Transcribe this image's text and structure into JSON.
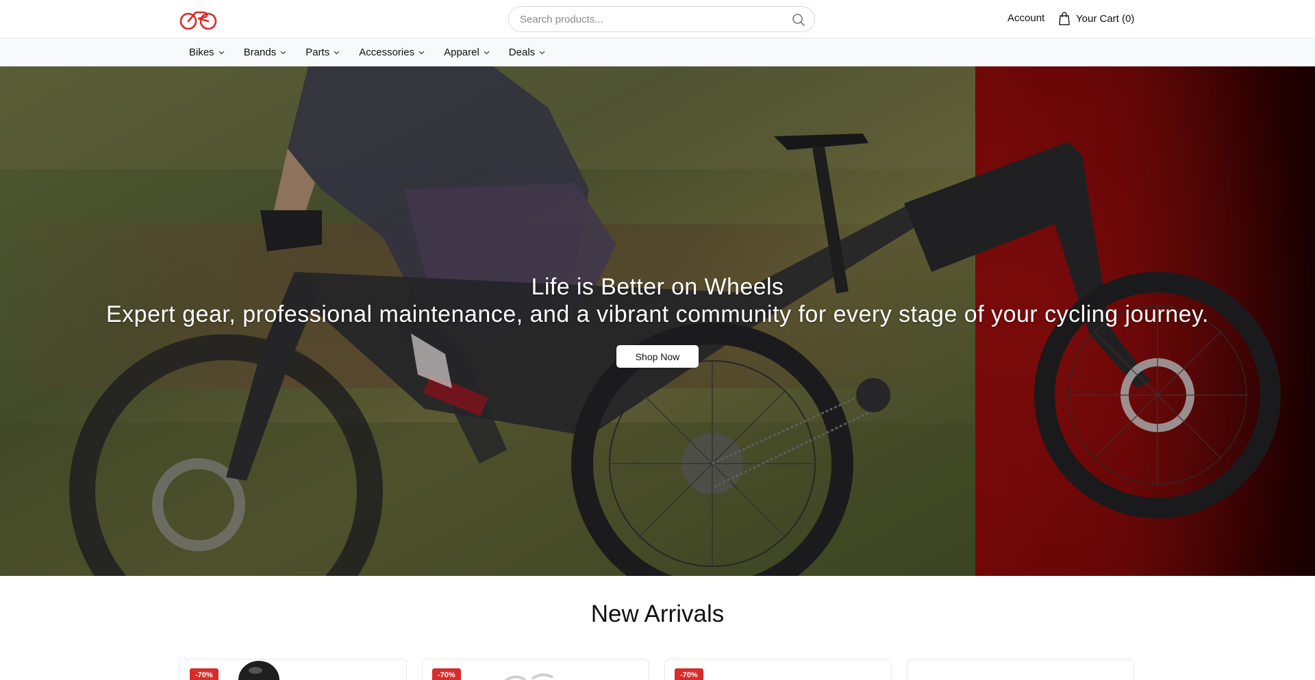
{
  "header": {
    "logo_alt": "Bike shop logo",
    "search_placeholder": "Search products...",
    "account_label": "Account",
    "cart_label": "Your Cart (0)"
  },
  "nav": {
    "items": [
      {
        "label": "Bikes"
      },
      {
        "label": "Brands"
      },
      {
        "label": "Parts"
      },
      {
        "label": "Accessories"
      },
      {
        "label": "Apparel"
      },
      {
        "label": "Deals"
      }
    ]
  },
  "hero": {
    "title": "Life is Better on Wheels",
    "subtitle": "Expert gear, professional maintenance, and a vibrant community for every stage of your cycling journey.",
    "button_label": "Shop Now"
  },
  "new_arrivals": {
    "title": "New Arrivals",
    "products": [
      {
        "badge": "-70%"
      },
      {
        "badge": "-70%"
      },
      {
        "badge": "-70%"
      },
      {
        "badge": ""
      }
    ]
  },
  "colors": {
    "brand_red": "#d62a2a",
    "badge_red": "#d92b2b",
    "hero_red_panel": "#7a0a0a"
  },
  "icons": [
    "bike-logo-icon",
    "search-icon",
    "shopping-bag-icon",
    "chevron-down-icon"
  ]
}
